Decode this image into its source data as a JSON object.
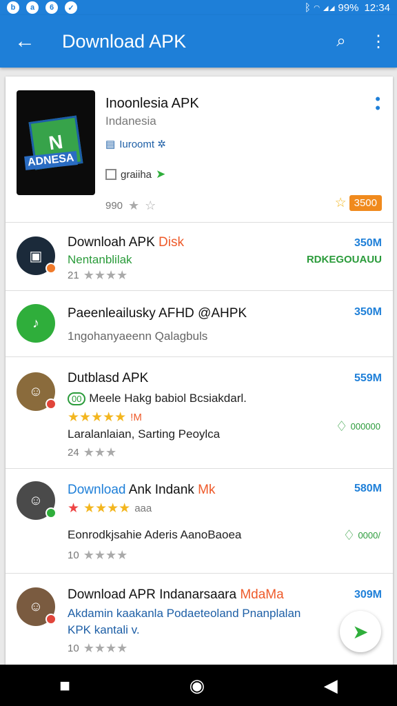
{
  "status": {
    "left_icons": [
      "b",
      "a",
      "6",
      "✓"
    ],
    "right_text": "ᛒ  ◠  ◢◢ 99%",
    "time": "12:34"
  },
  "appbar": {
    "title": "Download APK",
    "back_glyph": "←",
    "search_glyph": "⌕",
    "menu_glyph": "⋮"
  },
  "featured": {
    "title": "Inoonlesia APK",
    "subtitle": "Indanesia",
    "line1": "Iuroomt ✲",
    "line2": "graiiha",
    "rating_count": "990",
    "badge": "3500",
    "logo_text": "ADNESA"
  },
  "items": [
    {
      "title": "Downloah APK",
      "title_accent": "Disk",
      "size": "350M",
      "green": "Nentanblilak",
      "right_green": "RDKEGOUAUU",
      "rating": "21"
    },
    {
      "title": "Paeenleailusky AFHD @AHPK",
      "size": "350M",
      "grey": "1ngohanyaeenn  Qalagbuls"
    },
    {
      "title": "Dutblasd APK",
      "size": "559M",
      "line1_badge": "00",
      "line1": "Meele Hakg babiol Bcsiakdarl.",
      "line1_tag": "!M",
      "dark": "Laralanlaian, Sarting Peoylca",
      "rating": "24",
      "dl": "000000"
    },
    {
      "title": "Download",
      "title_rest": "Ank Indank",
      "title_accent": "Mk",
      "size": "580M",
      "stars_label": "aaa",
      "dark": "Eonrodkjsahie Aderis AanoBaoea",
      "rating": "10",
      "dl": "0000/"
    },
    {
      "title": "Download APR Indanarsaara",
      "title_accent": "MdaMa",
      "size": "309M",
      "blue1": "Akdamin kaakanla Podaeteoland Pnanplalan",
      "blue2": "KPK kantali v.",
      "rating": "10",
      "badge": "0"
    }
  ],
  "colors": {
    "primary": "#1e7fd8",
    "accent_green": "#2fae3b",
    "badge_orange": "#f08a1d"
  },
  "nav": {
    "recent": "■",
    "home": "◉",
    "back": "◀"
  }
}
